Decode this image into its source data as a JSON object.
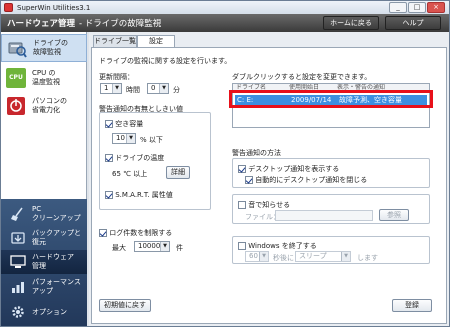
{
  "window": {
    "title": "SuperWin Utilities3.1",
    "controls": [
      "_",
      "□",
      "×"
    ]
  },
  "header": {
    "section": "ハードウェア管理",
    "subtitle": "- ドライブの故障監視",
    "home_button": "ホームに戻る",
    "help_button": "ヘルプ"
  },
  "sidebar": {
    "items": [
      {
        "label1": "ドライブの",
        "label2": "故障監視",
        "icon": "drive-monitor-icon"
      },
      {
        "label1": "CPU の",
        "label2": "温度監視",
        "icon": "cpu-icon",
        "icon_text": "CPU"
      },
      {
        "label1": "パソコンの",
        "label2": "省電力化",
        "icon": "power-saving-icon"
      }
    ],
    "lower_items": [
      {
        "label1": "PC",
        "label2": "クリーンアップ",
        "icon": "broom-icon"
      },
      {
        "label1": "バックアップと",
        "label2": "復元",
        "icon": "backup-icon"
      },
      {
        "label1": "ハードウェア",
        "label2": "管理",
        "icon": "hardware-icon"
      },
      {
        "label1": "パフォーマンス",
        "label2": "アップ",
        "icon": "performance-icon"
      },
      {
        "label1": "オプション",
        "label2": "",
        "icon": "options-gear-icon"
      }
    ]
  },
  "tabs": {
    "tab1": "ドライブ一覧",
    "tab2": "設定"
  },
  "settings": {
    "intro": "ドライブの監視に関する設定を行います。",
    "interval_label": "更新間隔：",
    "hours_value": "1",
    "hours_unit": "時間",
    "minutes_value": "0",
    "minutes_unit": "分",
    "warn_group_title": "警告通知の有無としきい値",
    "free_space_label": "空き容量",
    "free_space_value": "10",
    "free_space_unit": "% 以下",
    "temp_label": "ドライブの温度",
    "temp_value": "65 ℃ 以上",
    "detail_button": "詳細",
    "smart_label": "S.M.A.R.T. 属性値",
    "log_label": "ログ件数を制限する",
    "log_max_label": "最大",
    "log_max_value": "10000",
    "log_unit": "件",
    "reset_button": "初期値に戻す"
  },
  "drive_list": {
    "hint": "ダブルクリックすると設定を変更できます。",
    "columns": [
      "ドライブ名",
      "使用開始日",
      "表示・警告の通知"
    ],
    "rows": [
      {
        "drive": "C: E:",
        "date": "2009/07/14",
        "status": "故障予測、空き容量"
      }
    ],
    "highlight_color": "#e8101a",
    "selection_color": "#3d8fe0"
  },
  "notify": {
    "group_title": "警告通知の方法",
    "desktop_label": "デスクトップ通知を表示する",
    "auto_close_label": "自動的にデスクトップ通知を閉じる",
    "sound_label": "音で知らせる",
    "file_label": "ファイル：",
    "browse_button": "参照",
    "shutdown_label": "Windows を終了する",
    "shutdown_seconds": "60",
    "after_label": "秒後に",
    "shutdown_action": "スリープ",
    "do_label": "します",
    "register_button": "登録"
  }
}
